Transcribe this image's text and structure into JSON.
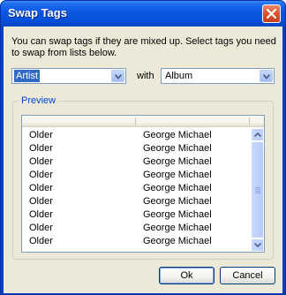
{
  "window": {
    "title": "Swap Tags"
  },
  "dialog": {
    "intro": "You can swap tags if they are mixed up. Select tags you need to swap from lists below.",
    "source_select": {
      "value": "Artist",
      "options": [
        "Artist"
      ]
    },
    "with_label": "with",
    "target_select": {
      "value": "Album",
      "options": [
        "Album"
      ]
    },
    "preview": {
      "label": "Preview",
      "columns": [
        "",
        ""
      ],
      "rows": [
        [
          "Older",
          "George Michael"
        ],
        [
          "Older",
          "George Michael"
        ],
        [
          "Older",
          "George Michael"
        ],
        [
          "Older",
          "George Michael"
        ],
        [
          "Older",
          "George Michael"
        ],
        [
          "Older",
          "George Michael"
        ],
        [
          "Older",
          "George Michael"
        ],
        [
          "Older",
          "George Michael"
        ],
        [
          "Older",
          "George Michael"
        ]
      ]
    },
    "ok_label": "Ok",
    "cancel_label": "Cancel"
  },
  "icons": {
    "close": "close-icon",
    "dropdown": "chevron-down-icon",
    "scroll_up": "chevron-up-icon",
    "scroll_down": "chevron-down-icon"
  },
  "colors": {
    "titlebar": "#0a55e2",
    "dialog_bg": "#ece9d8",
    "selection": "#316ac5",
    "group_label": "#0046d5"
  }
}
